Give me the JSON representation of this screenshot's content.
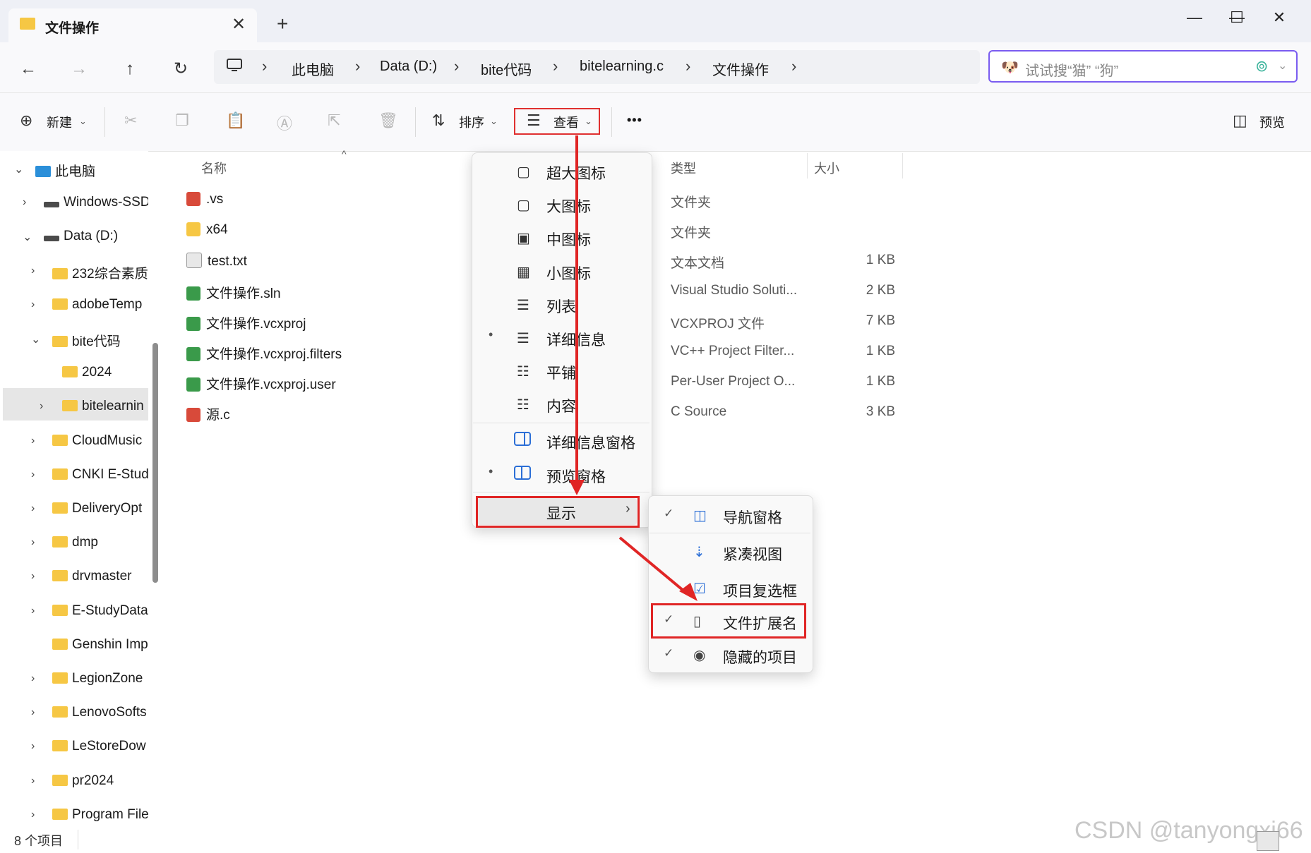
{
  "tab": {
    "title": "文件操作",
    "close": "✕",
    "new": "+"
  },
  "window": {
    "minimize": "—",
    "maximize": "☐",
    "close": "✕"
  },
  "nav": {
    "back": "←",
    "forward": "→",
    "up": "↑",
    "refresh": "↻"
  },
  "breadcrumb": [
    "此电脑",
    "Data (D:)",
    "bite代码",
    "bitelearning.c",
    "文件操作"
  ],
  "search": {
    "placeholder": "试试搜“猫” “狗”"
  },
  "toolbar": {
    "new": "新建",
    "sort": "排序",
    "view": "查看",
    "more": "•••",
    "preview": "预览"
  },
  "navpane": [
    {
      "label": "此电脑",
      "level": 0,
      "expanded": true
    },
    {
      "label": "Windows-SSD",
      "level": 1
    },
    {
      "label": "Data (D:)",
      "level": 1,
      "expanded": true
    },
    {
      "label": "232综合素质",
      "level": 2
    },
    {
      "label": "adobeTemp",
      "level": 2
    },
    {
      "label": "bite代码",
      "level": 2,
      "expanded": true
    },
    {
      "label": "2024",
      "level": 3
    },
    {
      "label": "bitelearnin",
      "level": 3,
      "selected": true
    },
    {
      "label": "CloudMusic",
      "level": 2
    },
    {
      "label": "CNKI E-Stud",
      "level": 2
    },
    {
      "label": "DeliveryOpt",
      "level": 2
    },
    {
      "label": "dmp",
      "level": 2
    },
    {
      "label": "drvmaster",
      "level": 2
    },
    {
      "label": "E-StudyData",
      "level": 2
    },
    {
      "label": "Genshin Imp",
      "level": 2
    },
    {
      "label": "LegionZone",
      "level": 2
    },
    {
      "label": "LenovoSofts",
      "level": 2
    },
    {
      "label": "LeStoreDow",
      "level": 2
    },
    {
      "label": "pr2024",
      "level": 2
    },
    {
      "label": "Program File",
      "level": 2
    }
  ],
  "columns": {
    "name": "名称",
    "type": "类型",
    "size": "大小"
  },
  "files": [
    {
      "name": ".vs",
      "type": "文件夹",
      "size": ""
    },
    {
      "name": "x64",
      "type": "文件夹",
      "size": ""
    },
    {
      "name": "test.txt",
      "type": "文本文档",
      "size": "1 KB"
    },
    {
      "name": "文件操作.sln",
      "type": "Visual Studio Soluti...",
      "size": "2 KB"
    },
    {
      "name": "文件操作.vcxproj",
      "type": "VCXPROJ 文件",
      "size": "7 KB"
    },
    {
      "name": "文件操作.vcxproj.filters",
      "type": "VC++ Project Filter...",
      "size": "1 KB"
    },
    {
      "name": "文件操作.vcxproj.user",
      "type": "Per-User Project O...",
      "size": "1 KB"
    },
    {
      "name": "源.c",
      "type": "C Source",
      "size": "3 KB"
    }
  ],
  "view_menu": {
    "items": [
      "超大图标",
      "大图标",
      "中图标",
      "小图标",
      "列表",
      "详细信息",
      "平铺",
      "内容"
    ],
    "panes": [
      "详细信息窗格",
      "预览窗格"
    ],
    "show": "显示",
    "bullet": "•"
  },
  "show_menu": {
    "items": [
      "导航窗格",
      "紧凑视图",
      "项目复选框",
      "文件扩展名",
      "隐藏的项目"
    ],
    "check": "✓"
  },
  "status": "8 个项目",
  "watermark": "CSDN @tanyongxi66",
  "colors": {
    "accent": "#7a5cf0",
    "highlight": "#e02525",
    "folder": "#f6c744"
  }
}
